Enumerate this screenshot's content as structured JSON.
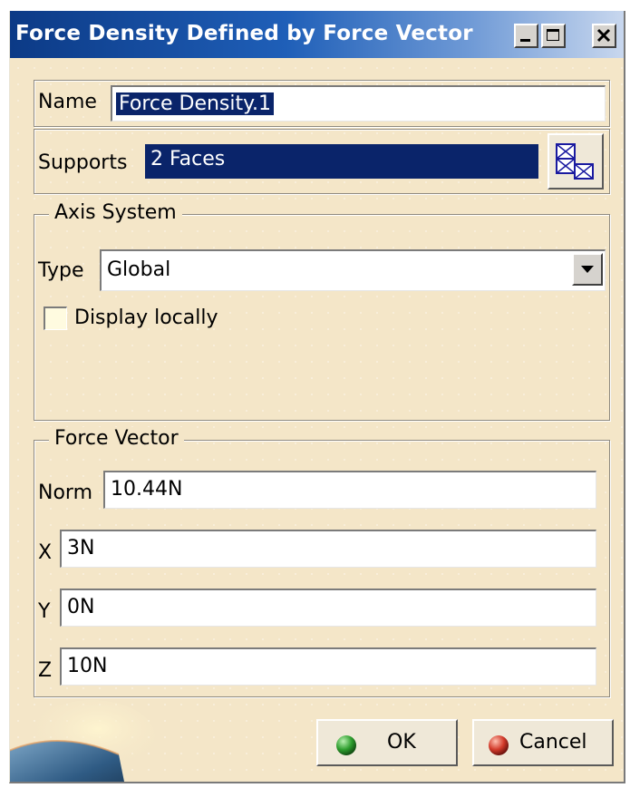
{
  "window": {
    "title": "Force Density Defined by Force Vector",
    "controls": [
      "minimize",
      "maximize",
      "close"
    ]
  },
  "name_row": {
    "label": "Name",
    "value": "Force Density.1"
  },
  "supports_row": {
    "label": "Supports",
    "value": "2 Faces",
    "button_icon": "faces-selection-icon"
  },
  "axis_system": {
    "legend": "Axis System",
    "type_label": "Type",
    "type_value": "Global",
    "display_locally_label": "Display locally",
    "display_locally_checked": false
  },
  "force_vector": {
    "legend": "Force Vector",
    "norm_label": "Norm",
    "norm_value": "10.44N",
    "x_label": "X",
    "x_value": "3N",
    "y_label": "Y",
    "y_value": "0N",
    "z_label": "Z",
    "z_value": "10N"
  },
  "buttons": {
    "ok_label": "OK",
    "ok_color": "#2e9e2e",
    "cancel_label": "Cancel",
    "cancel_color": "#d23a2a"
  }
}
